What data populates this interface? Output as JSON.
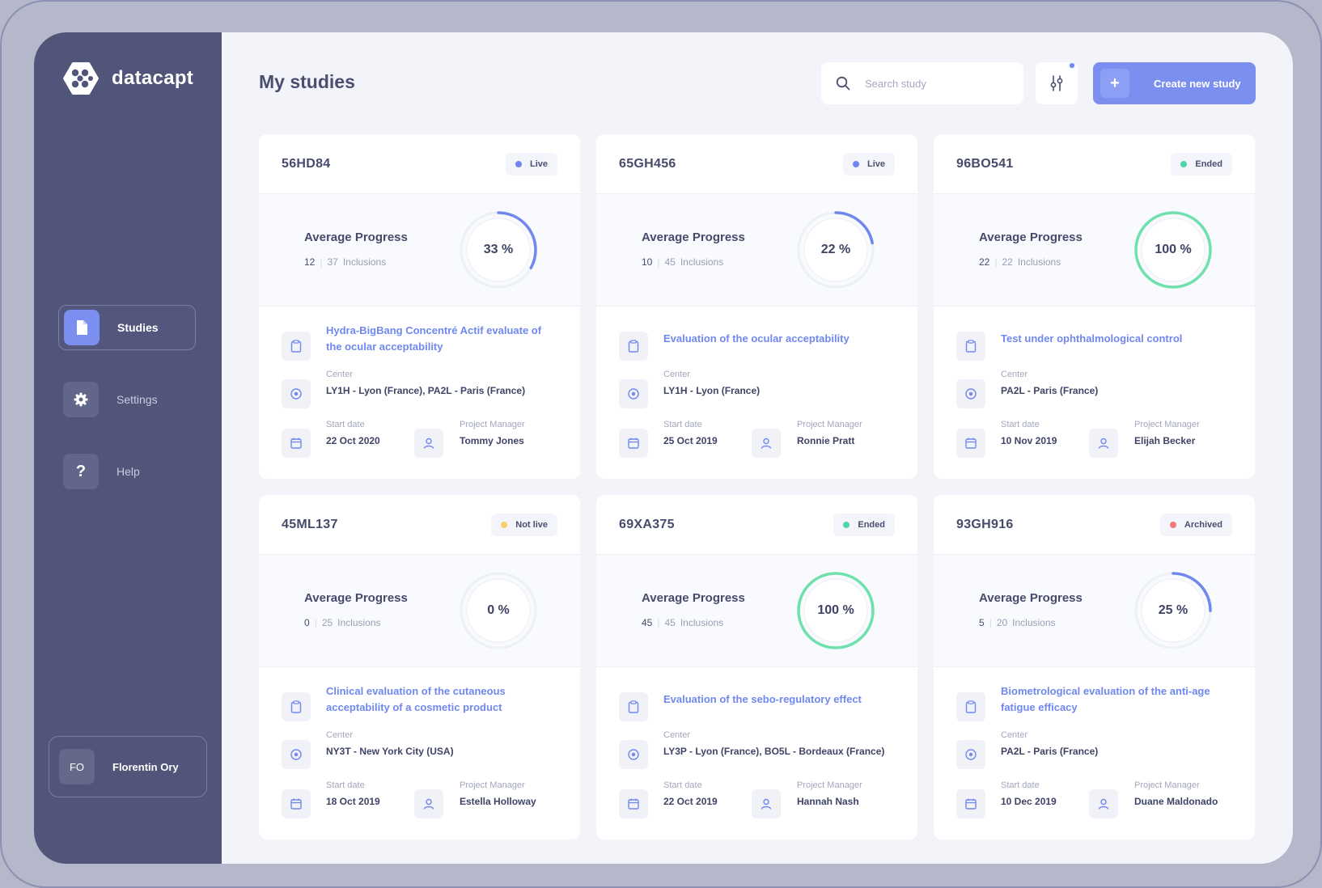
{
  "app": {
    "name": "datacapt"
  },
  "sidebar": {
    "items": [
      {
        "label": "Studies",
        "icon": "document-icon",
        "active": true
      },
      {
        "label": "Settings",
        "icon": "gear-icon",
        "active": false
      },
      {
        "label": "Help",
        "icon": "question-icon",
        "active": false
      }
    ],
    "user": {
      "initials": "FO",
      "name": "Florentin Ory"
    }
  },
  "header": {
    "title": "My studies",
    "search_placeholder": "Search study",
    "create_label": "Create new study",
    "create_icon": "+"
  },
  "labels": {
    "average_progress": "Average Progress",
    "inclusions": "Inclusions",
    "center": "Center",
    "start_date": "Start date",
    "project_manager": "Project Manager"
  },
  "colors": {
    "accent": "#7b8ff0",
    "live": "#6f86f0",
    "ended": "#4fd6a7",
    "not_live": "#f8cf6b",
    "archived": "#f2797a",
    "ring_progress": "#7088ee",
    "ring_complete": "#6fe0ae"
  },
  "studies": [
    {
      "id": "56HD84",
      "status": "Live",
      "status_color": "#6f86f0",
      "percent_label": "33 %",
      "progress": 0.33,
      "done": "12",
      "total": "37",
      "title": "Hydra-BigBang Concentré Actif evaluate of the ocular acceptability",
      "title_lines": 2,
      "center": "LY1H - Lyon (France), PA2L - Paris (France)",
      "start_date": "22 Oct 2020",
      "manager": "Tommy Jones"
    },
    {
      "id": "65GH456",
      "status": "Live",
      "status_color": "#6f86f0",
      "percent_label": "22 %",
      "progress": 0.22,
      "done": "10",
      "total": "45",
      "title": "Evaluation of the ocular acceptability",
      "title_lines": 1,
      "center": "LY1H - Lyon (France)",
      "start_date": "25 Oct 2019",
      "manager": "Ronnie Pratt"
    },
    {
      "id": "96BO541",
      "status": "Ended",
      "status_color": "#4fd6a7",
      "percent_label": "100 %",
      "progress": 1.0,
      "done": "22",
      "total": "22",
      "title": "Test under ophthalmological control",
      "title_lines": 1,
      "center": "PA2L - Paris (France)",
      "start_date": "10 Nov 2019",
      "manager": "Elijah Becker"
    },
    {
      "id": "45ML137",
      "status": "Not live",
      "status_color": "#f8cf6b",
      "percent_label": "0 %",
      "progress": 0.0,
      "done": "0",
      "total": "25",
      "title": "Clinical evaluation of the cutaneous acceptability of a cosmetic product",
      "title_lines": 2,
      "center": "NY3T - New York City (USA)",
      "start_date": "18 Oct 2019",
      "manager": "Estella Holloway"
    },
    {
      "id": "69XA375",
      "status": "Ended",
      "status_color": "#4fd6a7",
      "percent_label": "100 %",
      "progress": 1.0,
      "done": "45",
      "total": "45",
      "title": "Evaluation of the sebo-regulatory effect",
      "title_lines": 1,
      "center": "LY3P - Lyon (France), BO5L - Bordeaux (France)",
      "start_date": "22 Oct 2019",
      "manager": "Hannah Nash"
    },
    {
      "id": "93GH916",
      "status": "Archived",
      "status_color": "#f2797a",
      "percent_label": "25 %",
      "progress": 0.25,
      "done": "5",
      "total": "20",
      "title": "Biometrological evaluation of the anti-age fatigue efficacy",
      "title_lines": 2,
      "center": "PA2L - Paris (France)",
      "start_date": "10 Dec 2019",
      "manager": "Duane Maldonado"
    }
  ]
}
